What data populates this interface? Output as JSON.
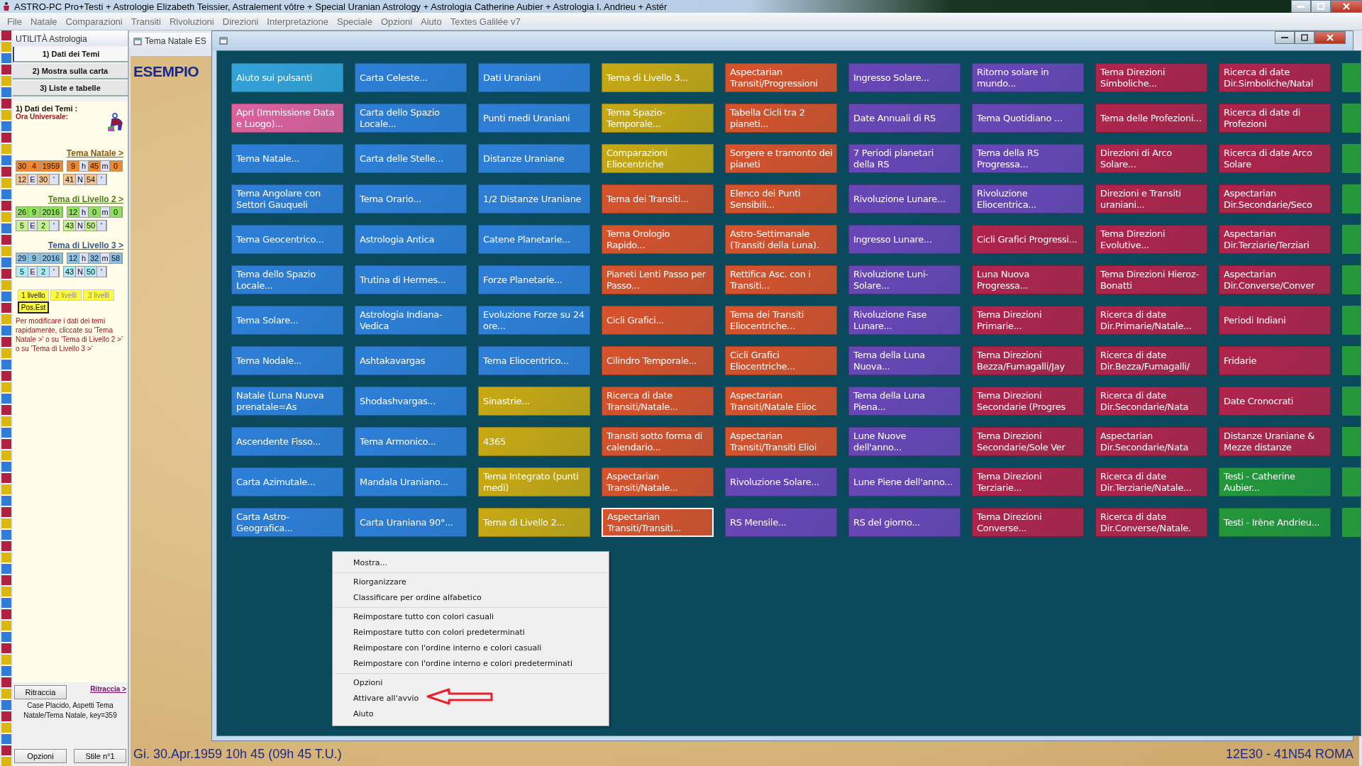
{
  "app_title": "ASTRO-PC Pro+Testi + Astrologie Elizabeth Teissier, Astralement vôtre + Special Uranian Astrology + Astrologia Catherine Aubier + Astrologia I. Andrieu + Astér",
  "menu": [
    "File",
    "Natale",
    "Comparazioni",
    "Transiti",
    "Rivoluzioni",
    "Direzioni",
    "Interpretazione",
    "Speciale",
    "Opzioni",
    "Aiuto",
    "Textes Galilée v7"
  ],
  "sidebar": {
    "title": "UTILITÀ Astrologia",
    "tabs": [
      {
        "label": "1) Dati dei Temi",
        "selected": true
      },
      {
        "label": "2) Mostra sulla carta",
        "selected": false
      },
      {
        "label": "3) Liste e tabelle",
        "selected": false
      }
    ],
    "group_title": "1) Dati dei Temi :",
    "ut_label": "Ora Universale:",
    "charts": [
      {
        "kind": "natal",
        "link": "Tema Natale >",
        "date": [
          "30",
          "4",
          "1959"
        ],
        "time": [
          "9",
          "h",
          "45",
          "m",
          "0"
        ],
        "lon": [
          "12",
          "E",
          "30",
          "'"
        ],
        "lat": [
          "41",
          "N",
          "54",
          "'"
        ]
      },
      {
        "kind": "level2",
        "link": "Tema di Livello 2 >",
        "date": [
          "26",
          "9",
          "2016"
        ],
        "time": [
          "12",
          "h",
          "0",
          "m",
          "0"
        ],
        "lon": [
          "5",
          "E",
          "2",
          "'"
        ],
        "lat": [
          "43",
          "N",
          "50",
          "'"
        ]
      },
      {
        "kind": "level3",
        "link": "Tema di Livello 3 >",
        "date": [
          "29",
          "9",
          "2016"
        ],
        "time": [
          "12",
          "h",
          "32",
          "m",
          "58"
        ],
        "lon": [
          "5",
          "E",
          "2",
          "'"
        ],
        "lat": [
          "43",
          "N",
          "50",
          "'"
        ]
      }
    ],
    "levels": [
      {
        "label": "1 livello",
        "selected": true
      },
      {
        "label": "2 livelli",
        "selected": false
      },
      {
        "label": "3 livelli",
        "selected": false
      }
    ],
    "pos_button": "Pos.Est",
    "hint": "Per modificare i dati dei temi rapidamente, cliccate su 'Tema Natale >' o su 'Tema di Livello 2 >' o su 'Tema di Livello 3 >'",
    "redraw_button": "Ritraccia",
    "redraw_link": "Ritraccia >",
    "info": "Case Placido, Aspetti Tema Natale/Tema Natale, key=359",
    "options_button": "Opzioni",
    "style_button": "Stile n°1"
  },
  "chart_window": {
    "tab": "Tema Natale ES",
    "heading": "ESEMPIO",
    "status_left": "Gi. 30.Apr.1959 10h 45 (09h 45 T.U.)",
    "status_right": "12E30 - 41N54  ROMA"
  },
  "buttons": [
    [
      {
        "label": "Aiuto sui pulsanti",
        "color": "#34a3da",
        "selected": false
      },
      {
        "label": "Apri (Immissione Data e Luogo)...",
        "color": "#e0609e",
        "selected": false
      },
      {
        "label": "Tema Natale...",
        "color": "#2e7fd9",
        "selected": false
      },
      {
        "label": "Tema Angolare con Settori Gauqueli",
        "color": "#2e7fd9",
        "selected": false
      },
      {
        "label": "Tema Geocentrico...",
        "color": "#2e7fd9",
        "selected": false
      },
      {
        "label": "Tema dello Spazio Locale...",
        "color": "#2e7fd9",
        "selected": false
      },
      {
        "label": "Tema Solare...",
        "color": "#2e7fd9",
        "selected": false
      },
      {
        "label": "Tema Nodale...",
        "color": "#2e7fd9",
        "selected": false
      },
      {
        "label": "Natale (Luna Nuova prenatale=As",
        "color": "#2e7fd9",
        "selected": false
      },
      {
        "label": "Ascendente Fisso...",
        "color": "#2e7fd9",
        "selected": false
      },
      {
        "label": "Carta Azimutale...",
        "color": "#2e7fd9",
        "selected": false
      },
      {
        "label": "Carta Astro-Geografica...",
        "color": "#2e7fd9",
        "selected": false
      }
    ],
    [
      {
        "label": "Carta Celeste...",
        "color": "#2e7fd9",
        "selected": false
      },
      {
        "label": "Carta dello Spazio Locale...",
        "color": "#2e7fd9",
        "selected": false
      },
      {
        "label": "Carta delle Stelle...",
        "color": "#2e7fd9",
        "selected": false
      },
      {
        "label": "Tema Orario...",
        "color": "#2e7fd9",
        "selected": false
      },
      {
        "label": "Astrologia Antica",
        "color": "#2e7fd9",
        "selected": false
      },
      {
        "label": "Trutina di Hermes...",
        "color": "#2e7fd9",
        "selected": false
      },
      {
        "label": "Astrologia Indiana-Vedica",
        "color": "#2e7fd9",
        "selected": false
      },
      {
        "label": "Ashtakavargas",
        "color": "#2e7fd9",
        "selected": false
      },
      {
        "label": "Shodashvargas...",
        "color": "#2e7fd9",
        "selected": false
      },
      {
        "label": "Tema Armonico...",
        "color": "#2e7fd9",
        "selected": false
      },
      {
        "label": "Mandala Uraniano...",
        "color": "#2e7fd9",
        "selected": false
      },
      {
        "label": "Carta Uraniana 90°...",
        "color": "#2e7fd9",
        "selected": false
      }
    ],
    [
      {
        "label": "Dati Uraniani",
        "color": "#2e7fd9",
        "selected": false
      },
      {
        "label": "Punti medi Uraniani",
        "color": "#2e7fd9",
        "selected": false
      },
      {
        "label": "Distanze Uraniane",
        "color": "#2e7fd9",
        "selected": false
      },
      {
        "label": "1/2 Distanze Uraniane",
        "color": "#2e7fd9",
        "selected": false
      },
      {
        "label": "Catene Planetarie...",
        "color": "#2e7fd9",
        "selected": false
      },
      {
        "label": "Forze Planetarie...",
        "color": "#2e7fd9",
        "selected": false
      },
      {
        "label": "Evoluzione Forze su 24 ore...",
        "color": "#2e7fd9",
        "selected": false
      },
      {
        "label": "Tema Eliocentrico...",
        "color": "#2e7fd9",
        "selected": false
      },
      {
        "label": "Sinastrie...",
        "color": "#c9a912",
        "selected": false
      },
      {
        "label": "4365",
        "color": "#c9a912",
        "selected": false
      },
      {
        "label": "Tema Integrato (punti medi)",
        "color": "#c9a912",
        "selected": false
      },
      {
        "label": "Tema di Livello 2...",
        "color": "#c9a912",
        "selected": false
      }
    ],
    [
      {
        "label": "Tema di Livello 3...",
        "color": "#c9a912",
        "selected": false
      },
      {
        "label": "Tema Spazio-Temporale...",
        "color": "#c9a912",
        "selected": false
      },
      {
        "label": "Comparazioni Eliocentriche",
        "color": "#c9a912",
        "selected": false
      },
      {
        "label": "Tema dei Transiti...",
        "color": "#d9522b",
        "selected": false
      },
      {
        "label": "Tema Orologio Rapido...",
        "color": "#d9522b",
        "selected": false
      },
      {
        "label": "Pianeti Lenti Passo per Passo...",
        "color": "#d9522b",
        "selected": false
      },
      {
        "label": "Cicli Grafici...",
        "color": "#d9522b",
        "selected": false
      },
      {
        "label": "Cilindro Temporale...",
        "color": "#d9522b",
        "selected": false
      },
      {
        "label": "Ricerca di date Transiti/Natale...",
        "color": "#d9522b",
        "selected": false
      },
      {
        "label": "Transiti sotto forma di calendario...",
        "color": "#d9522b",
        "selected": false
      },
      {
        "label": "Aspectarian Transiti/Natale...",
        "color": "#d9522b",
        "selected": false
      },
      {
        "label": "Aspectarian Transiti/Transiti...",
        "color": "#d9522b",
        "selected": true
      }
    ],
    [
      {
        "label": "Aspectarian Transiti/Progressioni",
        "color": "#d9522b",
        "selected": false
      },
      {
        "label": "Tabella Cicli tra 2 pianeti...",
        "color": "#d9522b",
        "selected": false
      },
      {
        "label": "Sorgere e tramonto dei pianeti",
        "color": "#d9522b",
        "selected": false
      },
      {
        "label": "Elenco dei Punti Sensibili...",
        "color": "#d9522b",
        "selected": false
      },
      {
        "label": "Astro-Settimanale (Transiti della Luna).",
        "color": "#d9522b",
        "selected": false
      },
      {
        "label": "Rettifica Asc. con i Transiti...",
        "color": "#d9522b",
        "selected": false
      },
      {
        "label": "Tema dei Transiti Eliocentriche...",
        "color": "#d9522b",
        "selected": false
      },
      {
        "label": "Cicli Grafici Eliocentriche...",
        "color": "#d9522b",
        "selected": false
      },
      {
        "label": "Aspectarian Transiti/Natale Elioc",
        "color": "#d9522b",
        "selected": false
      },
      {
        "label": "Aspectarian Transiti/Transiti Elioi",
        "color": "#d9522b",
        "selected": false
      },
      {
        "label": "Rivoluzione Solare...",
        "color": "#6a46b8",
        "selected": false
      },
      {
        "label": "RS Mensile...",
        "color": "#6a46b8",
        "selected": false
      }
    ],
    [
      {
        "label": "Ingresso Solare...",
        "color": "#6a46b8",
        "selected": false
      },
      {
        "label": "Date Annuali di RS",
        "color": "#6a46b8",
        "selected": false
      },
      {
        "label": "7 Periodi planetari della RS",
        "color": "#6a46b8",
        "selected": false
      },
      {
        "label": "Rivoluzione Lunare...",
        "color": "#6a46b8",
        "selected": false
      },
      {
        "label": "Ingresso Lunare...",
        "color": "#6a46b8",
        "selected": false
      },
      {
        "label": "Rivoluzione Luni-Solare...",
        "color": "#6a46b8",
        "selected": false
      },
      {
        "label": "Rivoluzione Fase Lunare...",
        "color": "#6a46b8",
        "selected": false
      },
      {
        "label": "Tema della Luna Nuova...",
        "color": "#6a46b8",
        "selected": false
      },
      {
        "label": "Tema della Luna Piena...",
        "color": "#6a46b8",
        "selected": false
      },
      {
        "label": "Lune Nuove dell'anno...",
        "color": "#6a46b8",
        "selected": false
      },
      {
        "label": "Lune Piene dell'anno...",
        "color": "#6a46b8",
        "selected": false
      },
      {
        "label": "RS del giorno...",
        "color": "#6a46b8",
        "selected": false
      }
    ],
    [
      {
        "label": "Ritorno solare in mundo...",
        "color": "#6a46b8",
        "selected": false
      },
      {
        "label": "Tema Quotidiano ...",
        "color": "#6a46b8",
        "selected": false
      },
      {
        "label": "Tema della RS Progressa...",
        "color": "#6a46b8",
        "selected": false
      },
      {
        "label": "Rivoluzione Eliocentrica...",
        "color": "#6a46b8",
        "selected": false
      },
      {
        "label": "Cicli Grafici Progressi...",
        "color": "#b2234b",
        "selected": false
      },
      {
        "label": "Luna Nuova Progressa...",
        "color": "#b2234b",
        "selected": false
      },
      {
        "label": "Tema Direzioni Primarie...",
        "color": "#b2234b",
        "selected": false
      },
      {
        "label": "Tema Direzioni Bezza/Fumagalli/Jay",
        "color": "#b2234b",
        "selected": false
      },
      {
        "label": "Tema Direzioni Secondarie (Progres",
        "color": "#b2234b",
        "selected": false
      },
      {
        "label": "Tema Direzioni Secondarie/Sole Ver",
        "color": "#b2234b",
        "selected": false
      },
      {
        "label": "Tema Direzioni Terziarie...",
        "color": "#b2234b",
        "selected": false
      },
      {
        "label": "Tema Direzioni Converse...",
        "color": "#b2234b",
        "selected": false
      }
    ],
    [
      {
        "label": "Tema Direzioni Simboliche...",
        "color": "#b2234b",
        "selected": false
      },
      {
        "label": "Tema delle Profezioni...",
        "color": "#b2234b",
        "selected": false
      },
      {
        "label": "Direzioni di Arco Solare...",
        "color": "#b2234b",
        "selected": false
      },
      {
        "label": "Direzioni e Transiti uraniani...",
        "color": "#b2234b",
        "selected": false
      },
      {
        "label": "Tema Direzioni Evolutive...",
        "color": "#b2234b",
        "selected": false
      },
      {
        "label": "Tema Direzioni Hieroz-Bonatti",
        "color": "#b2234b",
        "selected": false
      },
      {
        "label": "Ricerca di date Dir.Primarie/Natale...",
        "color": "#b2234b",
        "selected": false
      },
      {
        "label": "Ricerca di date Dir.Bezza/Fumagalli/",
        "color": "#b2234b",
        "selected": false
      },
      {
        "label": "Ricerca di date Dir.Secondarie/Nata",
        "color": "#b2234b",
        "selected": false
      },
      {
        "label": "Aspectarian Dir.Secondarie/Nata",
        "color": "#b2234b",
        "selected": false
      },
      {
        "label": "Ricerca di date Dir.Terziarie/Natale...",
        "color": "#b2234b",
        "selected": false
      },
      {
        "label": "Ricerca di date Dir.Converse/Natale.",
        "color": "#b2234b",
        "selected": false
      }
    ],
    [
      {
        "label": "Ricerca di date Dir.Simboliche/Natal",
        "color": "#b2234b",
        "selected": false
      },
      {
        "label": "Ricerca di date di Profezioni",
        "color": "#b2234b",
        "selected": false
      },
      {
        "label": "Ricerca di date Arco Solare",
        "color": "#b2234b",
        "selected": false
      },
      {
        "label": "Aspectarian Dir.Secondarie/Seco",
        "color": "#b2234b",
        "selected": false
      },
      {
        "label": "Aspectarian Dir.Terziarie/Terziari",
        "color": "#b2234b",
        "selected": false
      },
      {
        "label": "Aspectarian Dir.Converse/Conver",
        "color": "#b2234b",
        "selected": false
      },
      {
        "label": "Periodi Indiani",
        "color": "#b2234b",
        "selected": false
      },
      {
        "label": "Fridarie",
        "color": "#b2234b",
        "selected": false
      },
      {
        "label": "Date Cronocrati",
        "color": "#b2234b",
        "selected": false
      },
      {
        "label": "Distanze Uraniane & Mezze distanze",
        "color": "#b2234b",
        "selected": false
      },
      {
        "label": "Testi - Catherine Aubier...",
        "color": "#24983a",
        "selected": false
      },
      {
        "label": "Testi - Irène Andrieu...",
        "color": "#24983a",
        "selected": false
      }
    ]
  ],
  "edge_buttons": [
    {
      "color": "#24983a"
    },
    {
      "color": "#24983a"
    },
    {
      "color": "#24983a"
    },
    {
      "color": "#24983a"
    },
    {
      "color": "#24983a"
    },
    {
      "color": "#24983a"
    },
    {
      "color": "#24983a"
    },
    {
      "color": "#24983a"
    },
    {
      "color": "#24983a"
    },
    {
      "color": "#24983a"
    },
    {
      "color": "#24983a"
    },
    {
      "color": "#24983a"
    }
  ],
  "context_menu": [
    [
      {
        "label": "Mostra..."
      }
    ],
    [
      {
        "label": "Riorganizzare"
      },
      {
        "label": "Classificare per ordine alfabetico"
      }
    ],
    [
      {
        "label": "Reimpostare tutto con colori casuali"
      },
      {
        "label": "Reimpostare tutto con colori predeterminati"
      },
      {
        "label": "Reimpostare con l'ordine interno e colori casuali"
      },
      {
        "label": "Reimpostare con l'ordine interno e colori predeterminati"
      }
    ],
    [
      {
        "label": "Opzioni"
      },
      {
        "label": "Attivare all'avvio"
      },
      {
        "label": "Aiuto"
      }
    ]
  ]
}
